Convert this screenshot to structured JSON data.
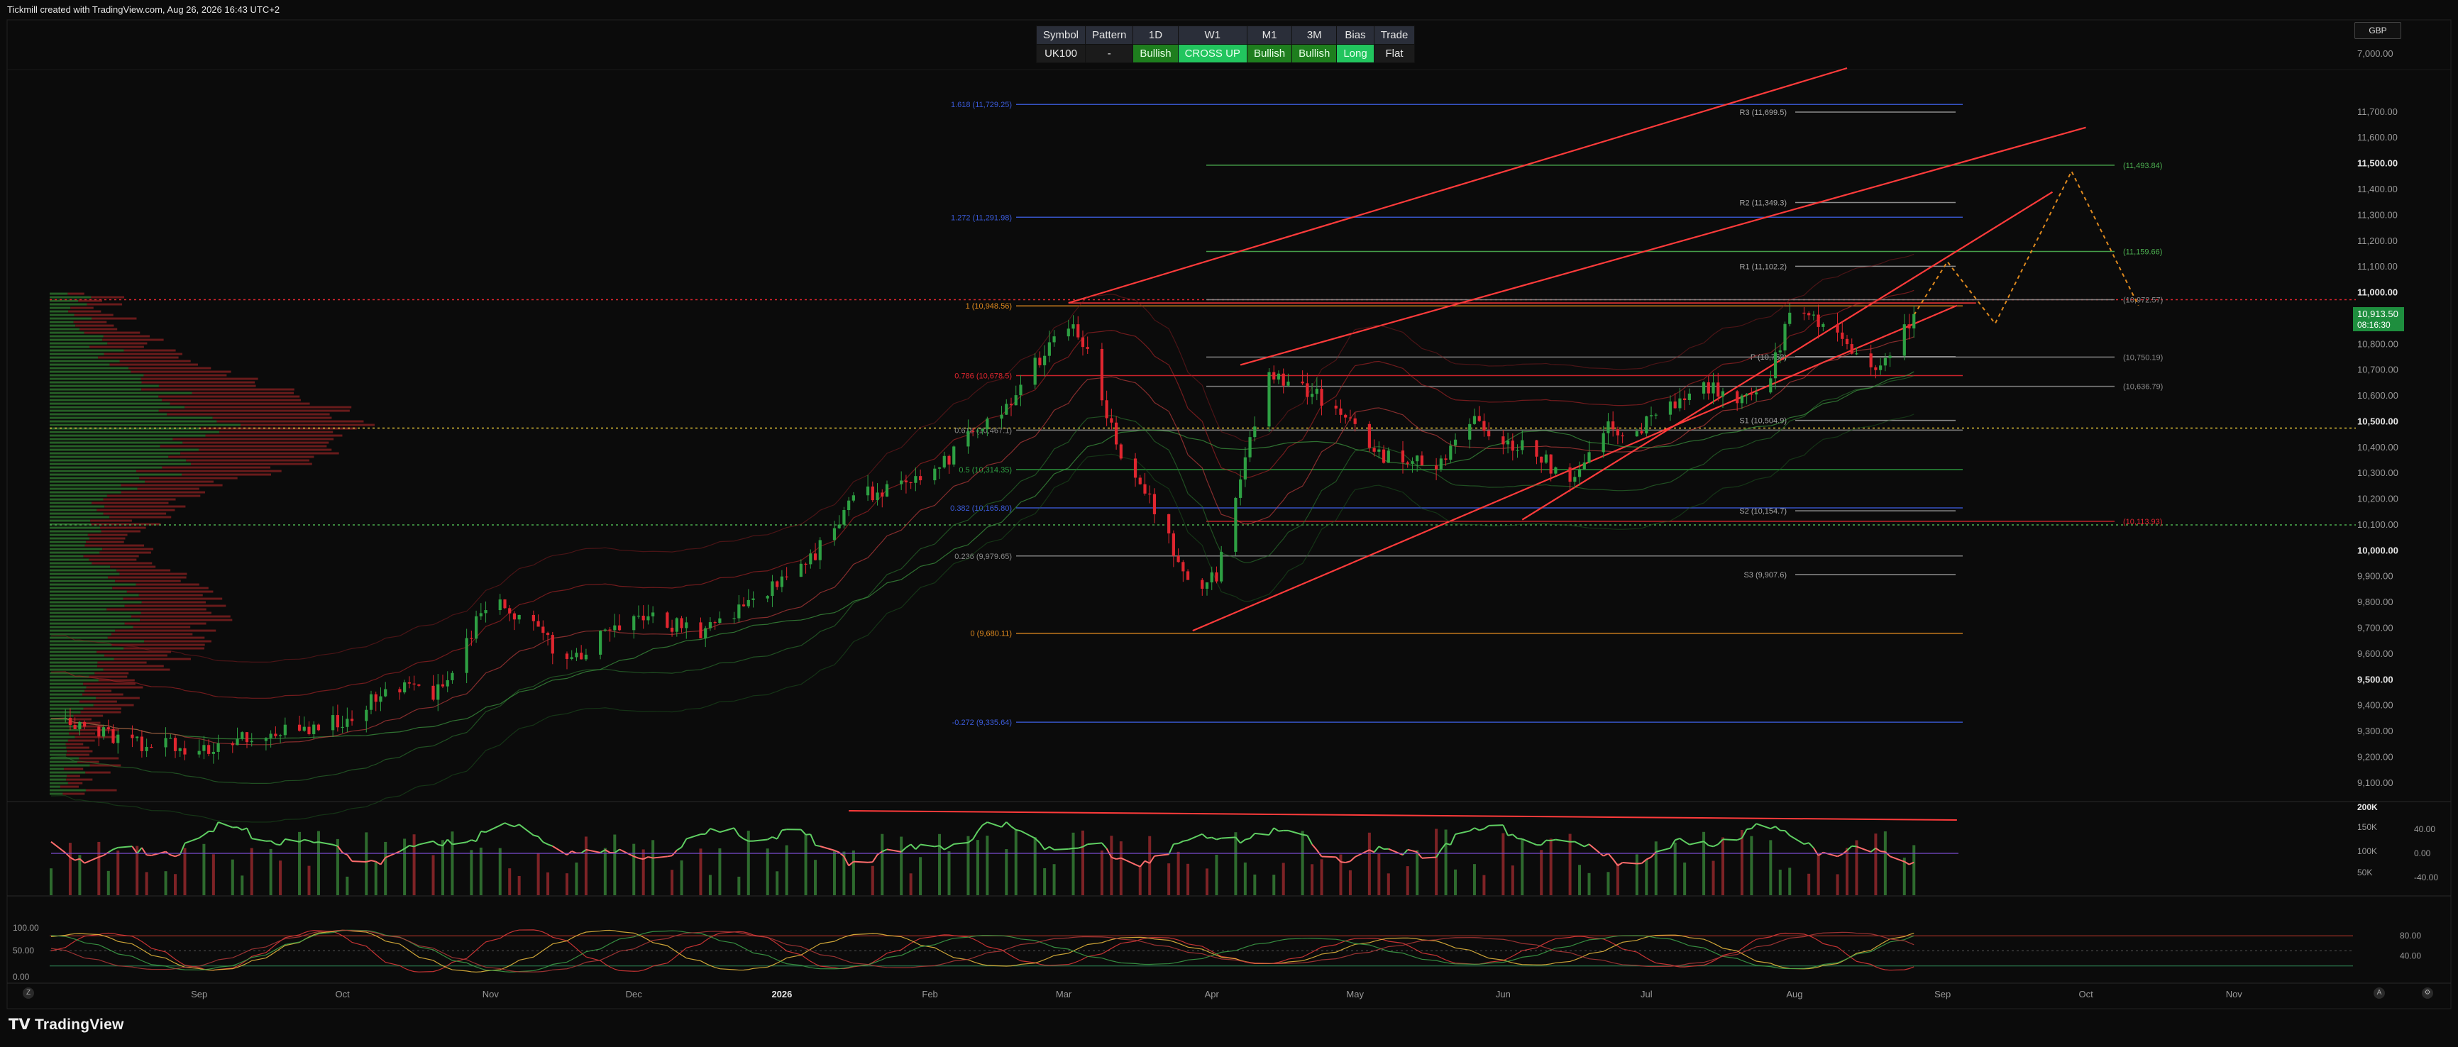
{
  "header": "Tickmill created with TradingView.com, Aug 26, 2026 16:43 UTC+2",
  "brand": "TradingView",
  "currency": "GBP",
  "panel": {
    "headers": [
      "Symbol",
      "Pattern",
      "1D",
      "W1",
      "M1",
      "3M",
      "Bias",
      "Trade"
    ],
    "values": [
      "UK100",
      "-",
      "Bullish",
      "CROSS UP",
      "Bullish",
      "Bullish",
      "Long",
      "Flat"
    ]
  },
  "colors": {
    "up": "#2ea043",
    "down": "#e0262f",
    "channel": "#ff3b3b",
    "fib_blue": "#3b5bd9",
    "fib_orange": "#e08a1e",
    "pivot": "#8c8c8c",
    "green_level": "#4caf50"
  },
  "chart_data": [
    {
      "type": "candlestick",
      "symbol": "UK100",
      "ylim": [
        9050,
        11870
      ],
      "price_ticks": [
        "11,700.00",
        "11,600.00",
        "11,500.00",
        "11,400.00",
        "11,300.00",
        "11,200.00",
        "11,100.00",
        "11,000.00",
        "10,900.00",
        "10,800.00",
        "10,700.00",
        "10,600.00",
        "10,500.00",
        "10,400.00",
        "10,300.00",
        "10,200.00",
        "10,100.00",
        "10,000.00",
        "9,900.00",
        "9,800.00",
        "9,700.00",
        "9,600.00",
        "9,500.00",
        "9,400.00",
        "9,300.00",
        "9,200.00",
        "9,100.00"
      ],
      "top_tick": "7,000.00",
      "time_labels": [
        "Sep",
        "Oct",
        "Nov",
        "Dec",
        "2026",
        "Feb",
        "Mar",
        "Apr",
        "May",
        "Jun",
        "Jul",
        "Aug",
        "Sep",
        "Oct",
        "Nov"
      ],
      "last_price": "10,913.50",
      "countdown": "08:16:30",
      "close_path": [
        [
          "2025-08-01",
          9380
        ],
        [
          "2025-08-15",
          9260
        ],
        [
          "2025-09-01",
          9230
        ],
        [
          "2025-09-12",
          9270
        ],
        [
          "2025-09-22",
          9300
        ],
        [
          "2025-10-01",
          9340
        ],
        [
          "2025-10-10",
          9480
        ],
        [
          "2025-10-20",
          9430
        ],
        [
          "2025-10-29",
          9720
        ],
        [
          "2025-11-03",
          9790
        ],
        [
          "2025-11-10",
          9700
        ],
        [
          "2025-11-18",
          9560
        ],
        [
          "2025-11-26",
          9700
        ],
        [
          "2025-12-05",
          9730
        ],
        [
          "2025-12-15",
          9690
        ],
        [
          "2025-12-23",
          9780
        ],
        [
          "2026-01-05",
          9920
        ],
        [
          "2026-01-15",
          10180
        ],
        [
          "2026-01-23",
          10250
        ],
        [
          "2026-02-02",
          10300
        ],
        [
          "2026-02-10",
          10480
        ],
        [
          "2026-02-18",
          10570
        ],
        [
          "2026-02-25",
          10780
        ],
        [
          "2026-03-03",
          10900
        ],
        [
          "2026-03-08",
          10650
        ],
        [
          "2026-03-13",
          10350
        ],
        [
          "2026-03-19",
          10220
        ],
        [
          "2026-03-24",
          9990
        ],
        [
          "2026-03-28",
          9820
        ],
        [
          "2026-04-02",
          9900
        ],
        [
          "2026-04-07",
          10300
        ],
        [
          "2026-04-13",
          10680
        ],
        [
          "2026-04-20",
          10620
        ],
        [
          "2026-04-27",
          10560
        ],
        [
          "2026-05-04",
          10390
        ],
        [
          "2026-05-11",
          10350
        ],
        [
          "2026-05-18",
          10330
        ],
        [
          "2026-05-25",
          10510
        ],
        [
          "2026-06-01",
          10440
        ],
        [
          "2026-06-08",
          10370
        ],
        [
          "2026-06-15",
          10280
        ],
        [
          "2026-06-22",
          10480
        ],
        [
          "2026-06-29",
          10460
        ],
        [
          "2026-07-06",
          10560
        ],
        [
          "2026-07-13",
          10640
        ],
        [
          "2026-07-20",
          10560
        ],
        [
          "2026-07-27",
          10700
        ],
        [
          "2026-08-01",
          10940
        ],
        [
          "2026-08-06",
          10880
        ],
        [
          "2026-08-11",
          10820
        ],
        [
          "2026-08-16",
          10720
        ],
        [
          "2026-08-21",
          10740
        ],
        [
          "2026-08-26",
          10913.5
        ]
      ],
      "fibonacci": [
        {
          "label": "1.618 (11,729.25)",
          "value": 11729.25,
          "color": "#3b5bd9"
        },
        {
          "label": "1.272 (11,291.98)",
          "value": 11291.98,
          "color": "#3b5bd9"
        },
        {
          "label": "1 (10,948.56)",
          "value": 10948.56,
          "color": "#e08a1e"
        },
        {
          "label": "0.786 (10,678.5)",
          "value": 10678.5,
          "color": "#e0262f"
        },
        {
          "label": "0.618 (10,467.1)",
          "value": 10467.1,
          "color": "#8c8c8c"
        },
        {
          "label": "0.5 (10,314.35)",
          "value": 10314.35,
          "color": "#2ea043"
        },
        {
          "label": "0.382 (10,165.80)",
          "value": 10165.8,
          "color": "#3b5bd9"
        },
        {
          "label": "0.236 (9,979.65)",
          "value": 9979.65,
          "color": "#8c8c8c"
        },
        {
          "label": "0 (9,680.11)",
          "value": 9680.11,
          "color": "#e08a1e"
        },
        {
          "label": "-0.272 (9,335.64)",
          "value": 9335.64,
          "color": "#3b5bd9"
        }
      ],
      "pivots": [
        {
          "label": "R3 (11,699.5)",
          "value": 11699.5
        },
        {
          "label": "R2 (11,349.3)",
          "value": 11349.3
        },
        {
          "label": "R1 (11,102.2)",
          "value": 11102.2
        },
        {
          "label": "P (10,752)",
          "value": 10752
        },
        {
          "label": "S1 (10,504.9)",
          "value": 10504.9
        },
        {
          "label": "S2 (10,154.7)",
          "value": 10154.7
        },
        {
          "label": "S3 (9,907.6)",
          "value": 9907.6
        }
      ],
      "right_levels": [
        {
          "label": "(11,493.84)",
          "value": 11493.84,
          "color": "#4caf50"
        },
        {
          "label": "(11,159.66)",
          "value": 11159.66,
          "color": "#4caf50"
        },
        {
          "label": "(10,972.57)",
          "value": 10972.57,
          "color": "#8c8c8c"
        },
        {
          "label": "(10,750.19)",
          "value": 10750.19,
          "color": "#8c8c8c"
        },
        {
          "label": "(10,636.79)",
          "value": 10636.79,
          "color": "#8c8c8c"
        },
        {
          "label": "(10,113.93)",
          "value": 10113.93,
          "color": "#e0262f"
        }
      ],
      "volume_ticks": [
        "200K",
        "150K",
        "100K",
        "50K"
      ],
      "rsi_ticks": [
        "40.00",
        "0.00",
        "-40.00"
      ],
      "stoch_ticks": [
        "100.00",
        "50.00",
        "0.00",
        "80.00",
        "40.00"
      ]
    }
  ]
}
